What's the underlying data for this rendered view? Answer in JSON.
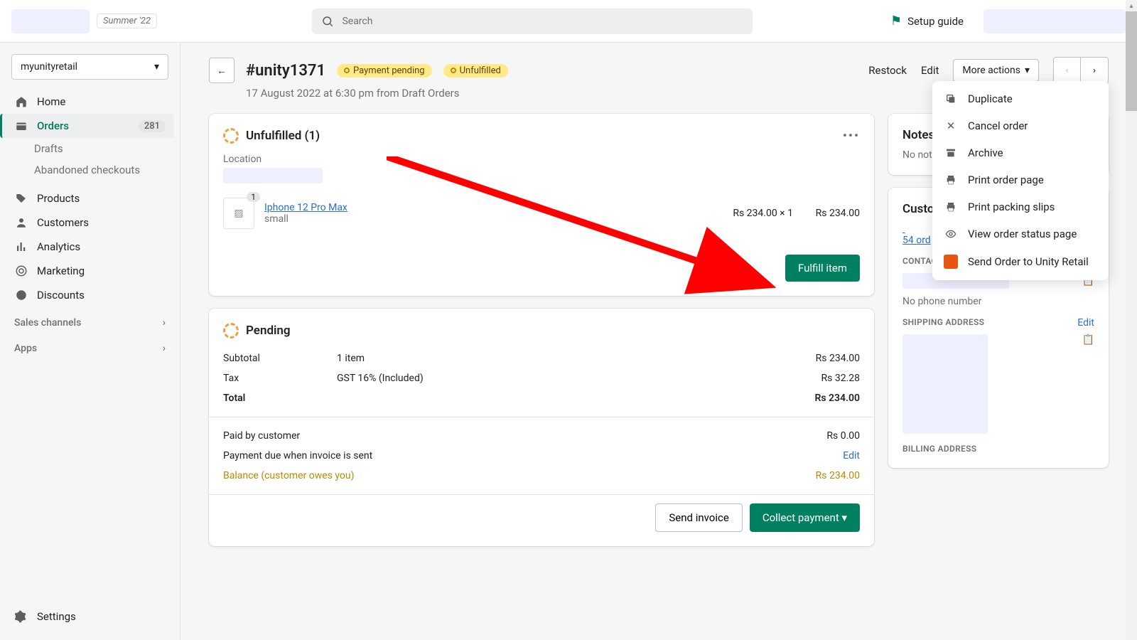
{
  "topbar": {
    "summer_badge": "Summer '22",
    "search_placeholder": "Search",
    "setup_guide": "Setup guide"
  },
  "sidebar": {
    "store_name": "myunityretail",
    "nav": {
      "home": "Home",
      "orders": "Orders",
      "orders_count": "281",
      "drafts": "Drafts",
      "abandoned": "Abandoned checkouts",
      "products": "Products",
      "customers": "Customers",
      "analytics": "Analytics",
      "marketing": "Marketing",
      "discounts": "Discounts",
      "sales_channels": "Sales channels",
      "apps": "Apps",
      "settings": "Settings"
    }
  },
  "order": {
    "title": "#unity1371",
    "badge_payment": "Payment pending",
    "badge_fulfillment": "Unfulfilled",
    "timestamp": "17 August 2022 at 6:30 pm from Draft Orders",
    "restock": "Restock",
    "edit": "Edit",
    "more_actions": "More actions"
  },
  "unfulfilled": {
    "title": "Unfulfilled (1)",
    "location_label": "Location",
    "item": {
      "qty_badge": "1",
      "name": "Iphone 12 Pro Max",
      "variant": "small",
      "unit_price": "Rs 234.00 × 1",
      "line_price": "Rs 234.00"
    },
    "fulfill_btn": "Fulfill item"
  },
  "pending": {
    "title": "Pending",
    "subtotal_label": "Subtotal",
    "subtotal_mid": "1 item",
    "subtotal_val": "Rs 234.00",
    "tax_label": "Tax",
    "tax_mid": "GST 16% (Included)",
    "tax_val": "Rs 32.28",
    "total_label": "Total",
    "total_val": "Rs 234.00",
    "paid_label": "Paid by customer",
    "paid_val": "Rs 0.00",
    "payment_due_label": "Payment due when invoice is sent",
    "payment_due_edit": "Edit",
    "balance_label": "Balance (customer owes you)",
    "balance_val": "Rs 234.00",
    "send_invoice": "Send invoice",
    "collect_payment": "Collect payment"
  },
  "side": {
    "notes_title": "Notes",
    "notes_body": "No notes fr",
    "customer_title": "Custome",
    "customer_orders": "54 ord",
    "contact_label": "CONTACT INFORMATION",
    "edit": "Edit",
    "no_phone": "No phone number",
    "shipping_label": "SHIPPING ADDRESS",
    "billing_label": "BILLING ADDRESS"
  },
  "dropdown": {
    "duplicate": "Duplicate",
    "cancel": "Cancel order",
    "archive": "Archive",
    "print_order": "Print order page",
    "print_packing": "Print packing slips",
    "view_status": "View order status page",
    "send_unity": "Send Order to Unity Retail"
  }
}
